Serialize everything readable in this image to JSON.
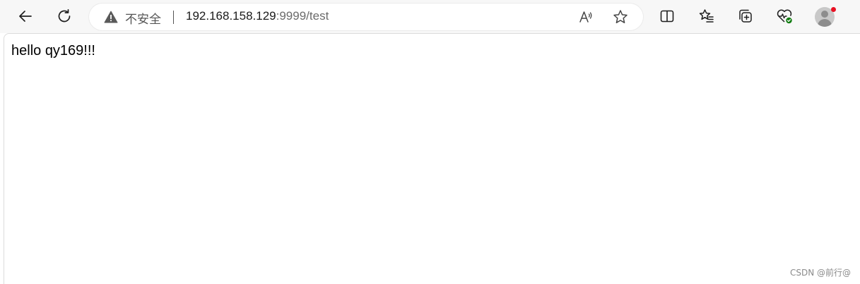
{
  "browser": {
    "security_label": "不安全",
    "url_host": "192.168.158.129",
    "url_path": ":9999/test",
    "profile_notification_color": "#e81123",
    "icons": [
      "back-arrow-icon",
      "refresh-icon",
      "warning-icon",
      "read-aloud-icon",
      "favorite-star-icon",
      "split-screen-icon",
      "favorites-list-icon",
      "collections-icon",
      "browser-essentials-icon",
      "profile-avatar-icon"
    ]
  },
  "page": {
    "body_text": "hello qy169!!!"
  },
  "watermark": {
    "text": "CSDN @前行@"
  }
}
